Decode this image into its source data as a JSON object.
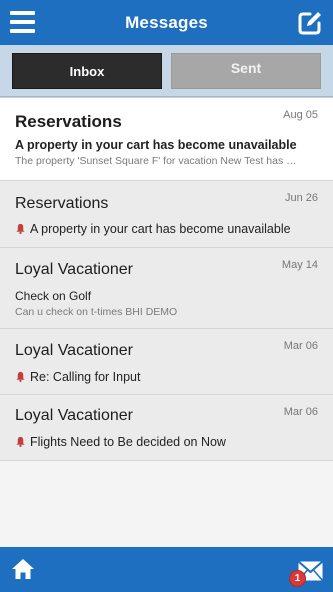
{
  "header": {
    "title": "Messages",
    "menu_icon": "hamburger-icon",
    "compose_icon": "compose-icon"
  },
  "tabs": {
    "inbox_label": "Inbox",
    "sent_label": "Sent",
    "active": "Inbox"
  },
  "messages": [
    {
      "from": "Reservations",
      "date": "Aug 05",
      "subject": "A property in your cart has become unavailable",
      "preview": "The property 'Sunset Square F' for vacation New Test has …",
      "unread": true,
      "alert": false
    },
    {
      "from": "Reservations",
      "date": "Jun 26",
      "subject": "A property in your cart has become unavailable",
      "preview": "",
      "unread": false,
      "alert": true
    },
    {
      "from": "Loyal Vacationer",
      "date": "May 14",
      "subject": "Check on Golf",
      "preview": "Can u check on t-times BHI DEMO",
      "unread": false,
      "alert": false
    },
    {
      "from": "Loyal Vacationer",
      "date": "Mar 06",
      "subject": "Re: Calling for Input",
      "preview": "",
      "unread": false,
      "alert": true
    },
    {
      "from": "Loyal Vacationer",
      "date": "Mar 06",
      "subject": "Flights Need to Be decided on Now",
      "preview": "",
      "unread": false,
      "alert": true
    }
  ],
  "bottom": {
    "home_icon": "home-icon",
    "mail_icon": "mail-icon",
    "mail_badge": "1"
  },
  "colors": {
    "brand": "#1f6fc0",
    "tab_active": "#2c2c2c",
    "tab_inactive": "#a7a7a7",
    "alert": "#c43c3c"
  }
}
